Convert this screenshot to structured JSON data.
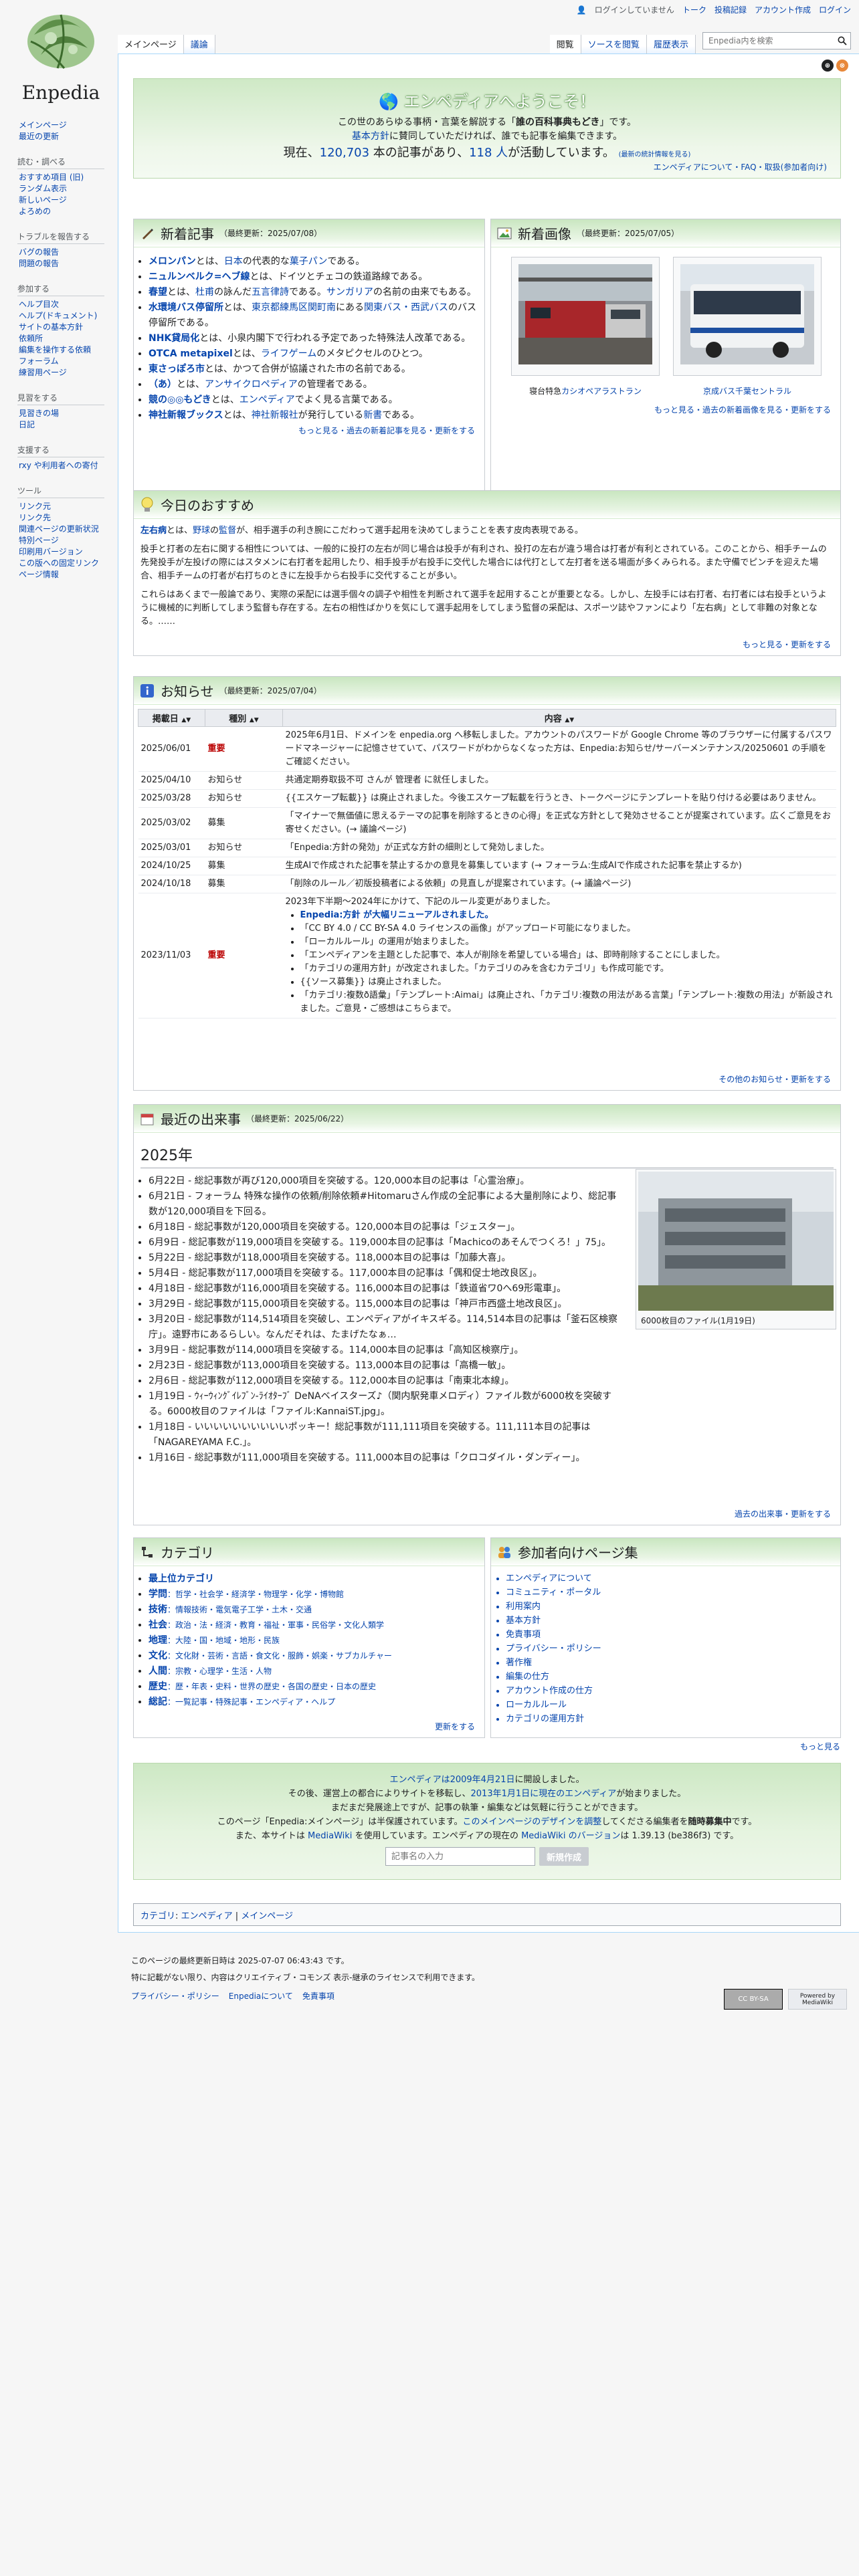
{
  "site": {
    "name": "Enpedia"
  },
  "personal": {
    "not_logged_in": "ログインしていません",
    "talk": "トーク",
    "contrib": "投稿記録",
    "create": "アカウント作成",
    "login": "ログイン"
  },
  "tabs": {
    "main": "メインページ",
    "discussion": "議論",
    "read": "閲覧",
    "source": "ソースを閲覧",
    "history": "履歴表示"
  },
  "search": {
    "placeholder": "Enpedia内を検索"
  },
  "sidebar": {
    "nav": [
      "メインページ",
      "最近の更新"
    ],
    "read_h": "読む・調べる",
    "read": [
      "おすすめ項目 (旧)",
      "ランダム表示",
      "新しいページ",
      "よろめの"
    ],
    "trouble_h": "トラブルを報告する",
    "trouble": [
      "バグの報告",
      "問題の報告"
    ],
    "join_h": "参加する",
    "join": [
      "ヘルプ目次",
      "ヘルプ(ドキュメント)",
      "サイトの基本方針",
      "依頼所",
      "編集を操作する依頼",
      "フォーラム",
      "練習用ページ"
    ],
    "support_h": "見習をする",
    "support": [
      "見習きの場",
      "日記"
    ],
    "assist_h": "支援する",
    "assist": [
      "rxy や利用者への寄付"
    ],
    "tools_h": "ツール",
    "tools": [
      "リンク元",
      "リンク先",
      "関連ページの更新状況",
      "特別ページ",
      "印刷用バージョン",
      "この版への固定リンク",
      "ページ情報"
    ]
  },
  "indicators": [
    "⊕",
    "⊗"
  ],
  "welcome": {
    "title": "エンペディアへようこそ！",
    "l1a": "この世のあらゆる事柄・言葉を解説する「",
    "l1b": "誰の百科事典もどき",
    "l1c": "」です。",
    "l2a": "基本方針",
    "l2b": "に賛同していただければ、誰でも記事を編集できます。",
    "l3a": "現在、",
    "count": "120,703",
    "l3b": " 本の記事があり、",
    "users": "118 人",
    "l3c": "が活動しています。",
    "l3d": "(最新の統計情報を見る)",
    "l4": "エンペディアについて・FAQ・取扱(参加者向け)"
  },
  "new_articles": {
    "title": "新着記事",
    "date": "（最終更新：2025/07/08）",
    "items": [
      {
        "a": "メロンパン",
        "b": "とは、",
        "c": "日本",
        "d": "の代表的な",
        "e": "菓子パン",
        "f": "である。"
      },
      {
        "a": "ニュルンベルク=ヘブ線",
        "b": "とは、ドイツとチェコの鉄道路線である。"
      },
      {
        "a": "春望",
        "b": "とは、",
        "c": "杜甫",
        "d": "の詠んだ",
        "e": "五言律詩",
        "f": "である。",
        "g": "サンガリア",
        "h": "の名前の由来でもある。"
      },
      {
        "a": "水環境バス停留所",
        "b": "とは、",
        "c": "東京都練馬区関町南",
        "d": "にある",
        "e": "関東バス・西武バス",
        "f": "のバス停留所である。"
      },
      {
        "a": "NHK貸局化",
        "b": "とは、小泉内閣下で行われる予定であった特殊法人改革である。"
      },
      {
        "a": "OTCA metapixel",
        "b": "とは、",
        "c": "ライフゲーム",
        "d": "のメタピクセルのひとつ。"
      },
      {
        "a": "東さっぽろ市",
        "b": "とは、かつて合併が協議された市の名前である。"
      },
      {
        "a": "（あ）",
        "b": "とは、",
        "c": "アンサイクロペディア",
        "d": "の管理者である。"
      },
      {
        "a": "競の◎◎もどき",
        "b": "とは、",
        "c": "エンペディア",
        "d": "でよく見る言葉である。"
      },
      {
        "a": "神社新報ブックス",
        "b": "とは、",
        "c": "神社新報社",
        "d": "が発行している",
        "e": "新書",
        "f": "である。"
      }
    ],
    "more": "もっと見る・過去の新着記事を見る・更新をする"
  },
  "new_images": {
    "title": "新着画像",
    "date": "（最終更新：2025/07/05）",
    "cap1a": "寝台特急",
    "cap1b": "カシオペアラストラン",
    "cap2": "京成バス千葉セントラル",
    "more": "もっと見る・過去の新着画像を見る・更新をする"
  },
  "recommend": {
    "title": "今日のおすすめ",
    "p1a": "左右病",
    "p1b": "とは、",
    "p1c": "野球",
    "p1d": "の",
    "p1e": "監督",
    "p1f": "が、相手選手の利き腕にこだわって選手起用を決めてしまうことを表す皮肉表現である。",
    "p2": "投手と打者の左右に関する相性については、一般的に投打の左右が同じ場合は投手が有利され、投打の左右が違う場合は打者が有利とされている。このことから、相手チームの先発投手が左投げの際にはスタメンに右打者を起用したり、相手投手が右投手に交代した場合には代打として左打者を送る場面が多くみられる。また守備でピンチを迎えた場合、相手チームの打者が右打ちのときに左投手から右投手に交代することが多い。",
    "p3": "これらはあくまで一般論であり、実際の采配には選手個々の調子や相性を判断されて選手を起用することが重要となる。しかし、左投手には右打者、右打者には右投手というように機械的に判断してしまう監督も存在する。左右の相性ばかりを気にして選手起用をしてしまう監督の采配は、スポーツ誌やファンにより「左右病」として非難の対象となる。……",
    "more": "もっと見る・更新をする"
  },
  "notice": {
    "title": "お知らせ",
    "date": "（最終更新：2025/07/04）",
    "h1": "掲載日",
    "h2": "種別",
    "h3": "内容",
    "rows": [
      {
        "d": "2025/06/01",
        "k": "重要",
        "c": "2025年6月1日、ドメインを enpedia.org へ移転しました。アカウントのパスワードが Google Chrome 等のブラウザーに付属するパスワードマネージャーに記憶させていて、パスワードがわからなくなった方は、Enpedia:お知らせ/サーバーメンテナンス/20250601 の手順をご確認ください。"
      },
      {
        "d": "2025/04/10",
        "k": "お知らせ",
        "c": "共通定期券取扱不可 さんが 管理者 に就任しました。"
      },
      {
        "d": "2025/03/28",
        "k": "お知らせ",
        "c": "{{エスケープ転載}} は廃止されました。今後エスケープ転載を行うとき、トークページにテンプレートを貼り付ける必要はありません。"
      },
      {
        "d": "2025/03/02",
        "k": "募集",
        "c": "「マイナーで無価値に思えるテーマの記事を削除するときの心得」を正式な方針として発効させることが提案されています。広くご意見をお寄せください。(→ 議論ページ)"
      },
      {
        "d": "2025/03/01",
        "k": "お知らせ",
        "c": "「Enpedia:方針の発効」が正式な方針の細則として発効しました。"
      },
      {
        "d": "2024/10/25",
        "k": "募集",
        "c": "生成AIで作成された記事を禁止するかの意見を募集しています (→ フォーラム:生成AIで作成された記事を禁止するか)"
      },
      {
        "d": "2024/10/18",
        "k": "募集",
        "c": "「削除のルール／初版投稿者による依頼」の見直しが提案されています。(→ 議論ページ)"
      }
    ],
    "last": {
      "d": "2023/11/03",
      "k": "重要",
      "intro": "2023年下半期〜2024年にかけて、下記のルール変更がありました。",
      "items": [
        "Enpedia:方針 が大幅リニューアルされました。",
        "「CC BY 4.0 / CC BY-SA 4.0 ライセンスの画像」がアップロード可能になりました。",
        "「ローカルルール」の運用が始まりました。",
        "「エンペディアンを主題とした記事で、本人が削除を希望している場合」は、即時削除することにしました。",
        "「カテゴリの運用方針」が改定されました。「カテゴリのみを含むカテゴリ」も作成可能です。",
        "{{ソース募集}} は廃止されました。",
        "「カテゴリ:複数ð語彙」「テンプレート:Aimai」は廃止され、「カテゴリ:複数の用法がある言葉」「テンプレート:複数の用法」が新設されました。ご意見・ご感想はこちらまで。"
      ]
    },
    "more": "その他のお知らせ・更新をする"
  },
  "events": {
    "title": "最近の出来事",
    "date": "（最終更新：2025/06/22）",
    "year": "2025年",
    "items": [
      "6月22日 - 総記事数が再び120,000項目を突破する。120,000本目の記事は「心霊治療」。",
      "6月21日 - フォーラム 特殊な操作の依頼/削除依頼#Hitomaruさん作成の全記事による大量削除により、総記事数が120,000項目を下回る。",
      "6月18日 - 総記事数が120,000項目を突破する。120,000本目の記事は「ジェスター」。",
      "6月9日 - 総記事数が119,000項目を突破する。119,000本目の記事は「Machicoのあそんでつくろ！」75」。",
      "5月22日 - 総記事数が118,000項目を突破する。118,000本目の記事は「加藤大喜」。",
      "5月4日 - 総記事数が117,000項目を突破する。117,000本目の記事は「偶和促士地改良区」。",
      "4月18日 - 総記事数が116,000項目を突破する。116,000本目の記事は「鉄道省ワ0へ69形電車」。",
      "3月29日 - 総記事数が115,000項目を突破する。115,000本目の記事は「神戸市西盛土地改良区」。",
      "3月20日 - 総記事数が114,514項目を突破し、エンペディアがイキスギる。114,514本目の記事は「釜石区検察庁」。遠野市にあるらしい。なんだそれは、たまげたなぁ…",
      "3月9日 - 総記事数が114,000項目を突破する。114,000本目の記事は「高知区検察庁」。",
      "2月23日 - 総記事数が113,000項目を突破する。113,000本目の記事は「高橋一敏」。",
      "2月6日 - 総記事数が112,000項目を突破する。112,000本目の記事は「南東北本線」。",
      "1月19日 - ｳｨｰｳｨﾝｸﾞｲﾚﾌﾞﾝ-ﾗｲｵﾀｰﾌﾞ DeNAベイスターズ♪（関内駅発車メロディ）ファイル数が6000枚を突破する。6000枚目のファイルは「ファイル:KannaiST.jpg」。",
      "1月18日 - いいいいいいいいいいポッキー！総記事数が111,111項目を突破する。111,111本目の記事は「NAGAREYAMA F.C.」。",
      "1月16日 - 総記事数が111,000項目を突破する。111,000本目の記事は「クロコダイル・ダンディー」。"
    ],
    "caption": "6000枚目のファイル(1月19日)",
    "more": "過去の出来事・更新をする"
  },
  "category": {
    "title": "カテゴリ",
    "items": [
      {
        "h": "最上位カテゴリ",
        "r": ""
      },
      {
        "h": "学問",
        "r": "：哲学・社会学・経済学・物理学・化学・博物館"
      },
      {
        "h": "技術",
        "r": "：情報技術・電気電子工学・土木・交通"
      },
      {
        "h": "社会",
        "r": "：政治・法・経済・教育・福祉・軍事・民俗学・文化人類学"
      },
      {
        "h": "地理",
        "r": "：大陸・国・地域・地形・民族"
      },
      {
        "h": "文化",
        "r": "：文化財・芸術・言語・食文化・服飾・娯楽・サブカルチャー"
      },
      {
        "h": "人間",
        "r": "：宗教・心理学・生活・人物"
      },
      {
        "h": "歴史",
        "r": "：歴・年表・史料・世界の歴史・各国の歴史・日本の歴史"
      },
      {
        "h": "総記",
        "r": "：一覧記事・特殊記事・エンペディア・ヘルプ"
      }
    ],
    "more": "更新をする"
  },
  "participants": {
    "title": "参加者向けページ集",
    "items": [
      "エンペディアについて",
      "コミュニティ・ポータル",
      "利用案内",
      "基本方針",
      "免責事項",
      "プライバシー・ポリシー",
      "著作権",
      "編集の仕方",
      "アカウント作成の仕方",
      "ローカルルール",
      "カテゴリの運用方針"
    ],
    "more": "もっと見る"
  },
  "bottom": {
    "l1a": "エンペディアは2009年4月21日",
    "l1b": "に開設しました。",
    "l2a": "その後、運営上の都合によりサイトを移転し、",
    "l2b": "2013年1月1日に現在のエンペディア",
    "l2c": "が始まりました。",
    "l3": "まだまだ発展途上ですが、記事の執筆・編集などは気軽に行うことができます。",
    "l4a": "このページ「Enpedia:メインページ」は半保護されています。",
    "l4b": "このメインページのデザインを調整",
    "l4c": "してくださる編集者を",
    "l4d": "随時募集中",
    "l4e": "です。",
    "l5a": "また、本サイトは ",
    "l5b": "MediaWiki",
    "l5c": " を使用しています。エンペディアの現在の ",
    "l5d": "MediaWiki のバージョン",
    "l5e": "は 1.39.13 (be386f3) です。",
    "input_ph": "記事名の入力",
    "create_btn": "新規作成"
  },
  "catlinks": {
    "label": "カテゴリ",
    "c1": "エンペディア",
    "c2": "メインページ"
  },
  "footer": {
    "lastmod": "このページの最終更新日時は 2025-07-07 06:43:43 です。",
    "license": "特に記載がない限り、内容はクリエイティブ・コモンズ 表示-継承のライセンスで利用できます。",
    "links": [
      "プライバシー・ポリシー",
      "Enpediaについて",
      "免責事項"
    ],
    "badge1": "CC BY-SA",
    "badge2": "Powered by MediaWiki"
  }
}
